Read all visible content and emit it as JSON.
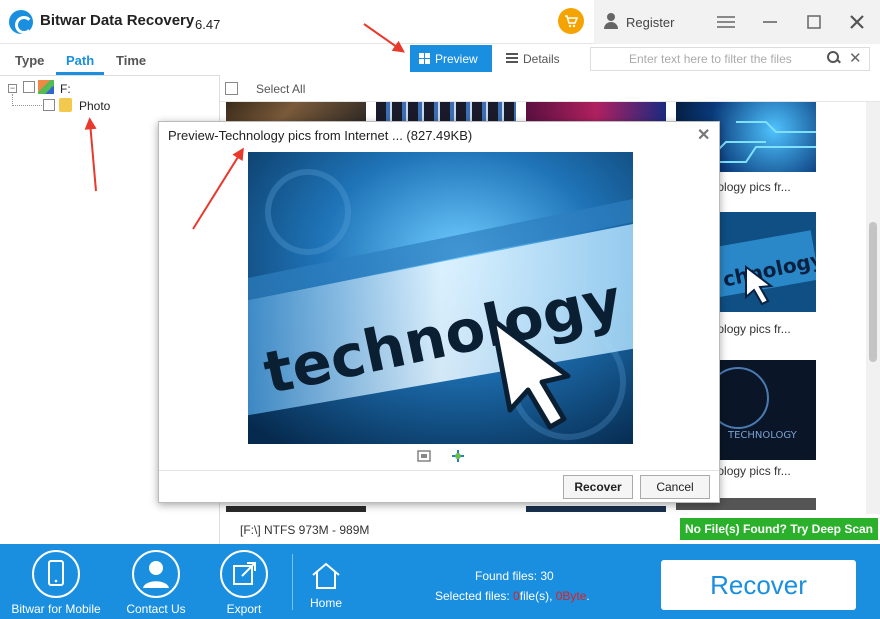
{
  "app": {
    "title": "Bitwar Data Recovery",
    "version": "6.47",
    "register": "Register"
  },
  "tabs": [
    {
      "label": "Type"
    },
    {
      "label": "Path"
    },
    {
      "label": "Time"
    }
  ],
  "view": {
    "preview_label": "Preview",
    "details_label": "Details"
  },
  "filter": {
    "placeholder": "Enter text here to filter the files"
  },
  "tree": {
    "drive": "F:",
    "folder": "Photo"
  },
  "list": {
    "select_all": "Select All",
    "captions": [
      "hnology pics fr...",
      "hnology pics fr...",
      "hnology pics fr..."
    ]
  },
  "status": {
    "path_info": "[F:\\] NTFS 973M - 989M",
    "deep_scan": "No File(s) Found? Try Deep Scan"
  },
  "dialog": {
    "title": "Preview-Technology pics from Internet ... (827.49KB)",
    "image_word": "technology",
    "thumb_word": "TECHNOLOGY",
    "recover_label": "Recover",
    "cancel_label": "Cancel"
  },
  "bottom": {
    "mobile_label": "Bitwar for Mobile",
    "contact_label": "Contact Us",
    "export_label": "Export",
    "home_label": "Home",
    "found_label": "Found files: 30",
    "selected_prefix": "Selected files: ",
    "selected_count": "0",
    "selected_mid": "file(s), ",
    "selected_size": "0Byte",
    "selected_suffix": ".",
    "recover_label": "Recover"
  },
  "colors": {
    "accent": "#1a8fe0",
    "cart": "#f5a300",
    "deep_scan": "#2bb02b",
    "annotation_arrow": "#e8392c"
  },
  "icons": [
    "app-logo-icon",
    "cart-icon",
    "user-icon",
    "menu-icon",
    "minimize-icon",
    "maximize-icon",
    "close-icon",
    "grid-icon",
    "list-icon",
    "search-icon",
    "clear-icon",
    "drive-icon",
    "folder-icon",
    "fit-screen-icon",
    "actual-size-icon",
    "mobile-icon",
    "contact-icon",
    "export-icon",
    "home-icon"
  ]
}
